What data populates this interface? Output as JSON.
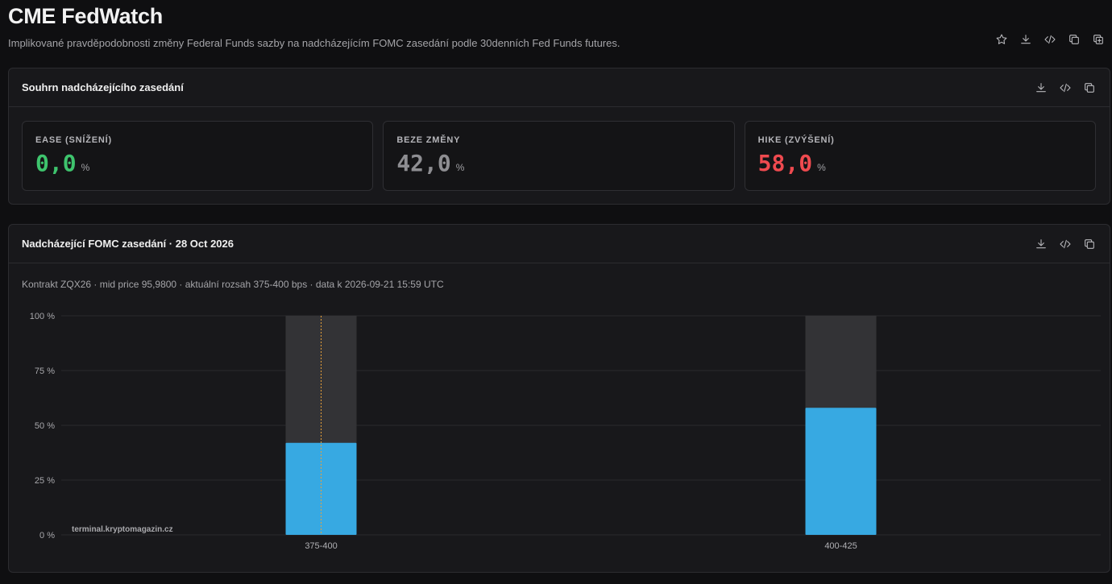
{
  "page": {
    "title": "CME FedWatch",
    "subtitle": "Implikované pravděpodobnosti změny Federal Funds sazby na nadcházejícím FOMC zasedání podle 30denních Fed Funds futures."
  },
  "top_actions": [
    "star-icon",
    "download-icon",
    "code-icon",
    "copy-icon",
    "duplicate-icon"
  ],
  "summary": {
    "title": "Souhrn nadcházejícího zasedání",
    "actions": [
      "download-icon",
      "code-icon",
      "copy-icon"
    ],
    "cards": {
      "ease": {
        "label": "EASE (SNÍŽENÍ)",
        "value": "0,0",
        "unit": "%"
      },
      "nochange": {
        "label": "BEZE ZMĚNY",
        "value": "42,0",
        "unit": "%"
      },
      "hike": {
        "label": "HIKE (ZVÝŠENÍ)",
        "value": "58,0",
        "unit": "%"
      }
    }
  },
  "meeting": {
    "title": "Nadcházející FOMC zasedání · 28 Oct 2026",
    "actions": [
      "download-icon",
      "code-icon",
      "copy-icon"
    ],
    "meta": "Kontrakt ZQX26 · mid price 95,9800 · aktuální rozsah 375-400 bps · data k 2026-09-21 15:59 UTC",
    "watermark": "terminal.kryptomagazin.cz"
  },
  "colors": {
    "ease": "#3ec46d",
    "nochange": "#8e8e92",
    "hike": "#ef4a4f",
    "bar": "#37a9e2",
    "bar_track": "#333336",
    "current_marker": "#e8a13a"
  },
  "chart_data": {
    "type": "bar",
    "categories": [
      "375-400",
      "400-425"
    ],
    "values": [
      42.0,
      58.0
    ],
    "ylim": [
      0,
      100
    ],
    "yticks": [
      "0 %",
      "25 %",
      "50 %",
      "75 %",
      "100 %"
    ],
    "ytick_values": [
      0,
      25,
      50,
      75,
      100
    ],
    "current_range": "375-400",
    "grid": true,
    "title": "",
    "xlabel": "",
    "ylabel": ""
  }
}
